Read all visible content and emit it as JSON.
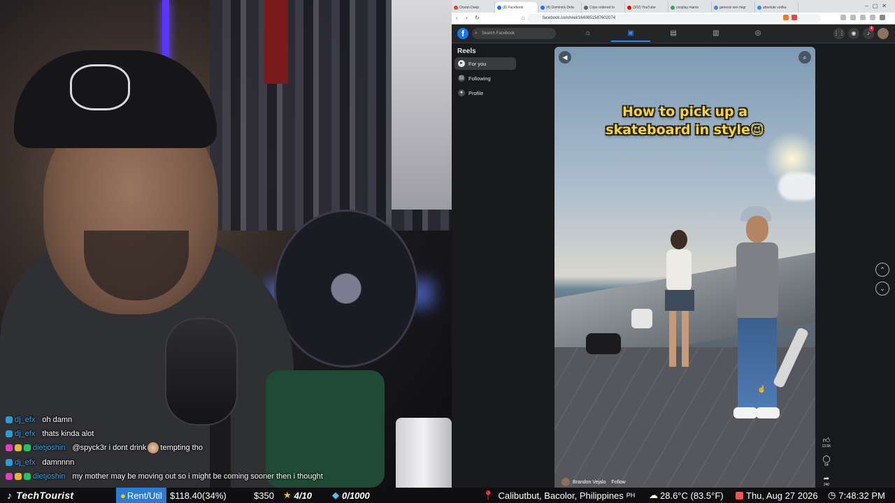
{
  "chat": [
    {
      "user": "dj_efx",
      "message": "oh damn",
      "badges": [
        "blue"
      ]
    },
    {
      "user": "dj_efx",
      "message": "thats kinda alot",
      "badges": [
        "blue"
      ]
    },
    {
      "user": "dietjoshin",
      "message_before": "@spyck3r i dont drink",
      "message_after": "tempting tho",
      "badges": [
        "pink",
        "yellow",
        "green"
      ]
    },
    {
      "user": "dj_efx",
      "message": "damnnnn",
      "badges": [
        "blue"
      ]
    },
    {
      "user": "dietjoshin",
      "message": "my mother may be moving out so i might be coming sooner then i thought",
      "badges": [
        "pink",
        "yellow",
        "green"
      ]
    }
  ],
  "browser": {
    "tabs": [
      {
        "title": "Ocean Deep",
        "active": false,
        "icon_color": "#ea4335"
      },
      {
        "title": "(8) Facebook",
        "active": true,
        "icon_color": "#1877f2"
      },
      {
        "title": "(4) Dominick Dela",
        "active": false,
        "icon_color": "#1877f2"
      },
      {
        "title": "Cops ordered to",
        "active": false,
        "icon_color": "#5f6368"
      },
      {
        "title": "(302) YouTube",
        "active": false,
        "icon_color": "#ff0000"
      },
      {
        "title": "cosplay mania",
        "active": false,
        "icon_color": "#34a853"
      },
      {
        "title": "genesis sen migr",
        "active": false,
        "icon_color": "#4285f4"
      },
      {
        "title": "absolute vodka",
        "active": false,
        "icon_color": "#4285f4"
      }
    ],
    "url": "facebook.com/reel/1640851587602074"
  },
  "facebook": {
    "search_placeholder": "Search Facebook",
    "notification_count": "4",
    "reels_title": "Reels",
    "sidebar": [
      {
        "label": "For you",
        "icon": "reels-icon",
        "active": true
      },
      {
        "label": "Following",
        "icon": "following-icon",
        "active": false
      },
      {
        "label": "Profile",
        "icon": "profile-icon",
        "active": false
      }
    ],
    "reel": {
      "caption_line1": "How to pick up a",
      "caption_line2": "skateboard in style",
      "caption_emoji": "😉",
      "author": "Brandon Vejalo",
      "follow": "Follow",
      "likes": "13.5K",
      "comments": "54",
      "shares": "240"
    }
  },
  "streambar": {
    "brand": "TechTourist",
    "goal_label": "Rent/Util",
    "goal_value": "$118.40(34%)",
    "tip": "$350",
    "stars": "4/10",
    "gems": "0/1000",
    "location": "Calibutbut, Bacolor, Philippines",
    "country": "PH",
    "weather": "28.6°C (83.5°F)",
    "date": "Thu, Aug 27 2026",
    "time": "7:48:32 PM",
    "colors": {
      "tag_blue": "#2c7bd1",
      "gold": "#f5c518",
      "gem": "#49c5ff"
    }
  }
}
